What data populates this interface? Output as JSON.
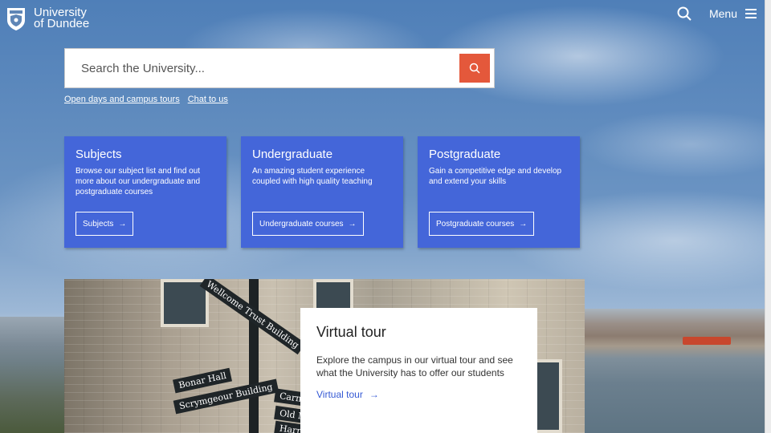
{
  "header": {
    "logo_line1": "University",
    "logo_line2": "of Dundee",
    "menu_label": "Menu",
    "icons": {
      "search": "search-icon",
      "menu": "hamburger-icon",
      "logo": "university-crest-icon"
    }
  },
  "search": {
    "placeholder": "Search the University...",
    "value": "",
    "button_icon": "search-icon",
    "accent": "#e4583b"
  },
  "quick_links": [
    "Open days and campus tours",
    "Chat to us"
  ],
  "cards": [
    {
      "title": "Subjects",
      "description": "Browse our subject list and find out more about our undergraduate and postgraduate courses",
      "button": "Subjects"
    },
    {
      "title": "Undergraduate",
      "description": "An amazing student experience coupled with high quality teaching",
      "button": "Undergraduate courses"
    },
    {
      "title": "Postgraduate",
      "description": "Gain a competitive edge and develop and extend your skills",
      "button": "Postgraduate courses"
    }
  ],
  "card_color": "#4466d9",
  "virtual_tour": {
    "title": "Virtual tour",
    "description": "Explore the campus in our virtual tour and see what the University has to offer our students",
    "link": "Virtual tour",
    "link_color": "#3559d4",
    "photo_signs": [
      "Wellcome Trust Building",
      "Bonar Hall",
      "Scrymgeour Building",
      "Carnell",
      "Old Med",
      "Harris"
    ]
  }
}
